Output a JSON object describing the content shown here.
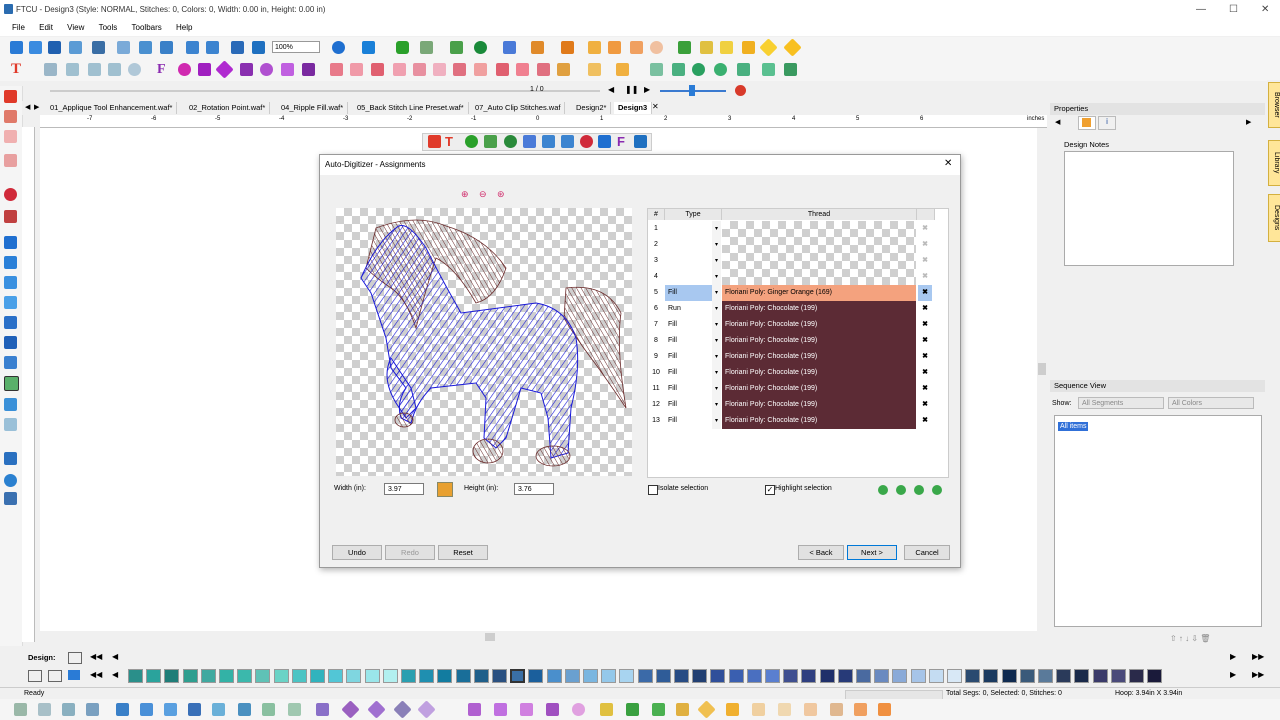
{
  "window": {
    "title": "FTCU - Design3 (Style: NORMAL, Stitches: 0, Colors: 0, Width: 0.00 in, Height: 0.00 in)",
    "minimize": "—",
    "maximize": "☐",
    "close": "✕"
  },
  "menu": [
    "File",
    "Edit",
    "View",
    "Tools",
    "Toolbars",
    "Help"
  ],
  "toolbar": {
    "zoom": "100%",
    "page_counter": "1 / 0"
  },
  "tabs": [
    "01_Applique Tool Enhancement.waf*",
    "02_Rotation Point.waf*",
    "04_Ripple Fill.waf*",
    "05_Back Stitch Line Preset.waf*",
    "07_Auto Clip Stitches.waf",
    "Design2*",
    "Design3"
  ],
  "ruler": {
    "ticks": [
      "-7",
      "-6",
      "-5",
      "-4",
      "-3",
      "-2",
      "-1",
      "0",
      "1",
      "2",
      "3",
      "4",
      "5",
      "6"
    ],
    "unit": "inches"
  },
  "dialog": {
    "title": "Auto-Digitizer - Assignments",
    "width_label": "Width (in):",
    "width_value": "3.97",
    "height_label": "Height (in):",
    "height_value": "3.76",
    "isolate_label": "Isolate selection",
    "isolate_checked": false,
    "highlight_label": "Highlight selection",
    "highlight_checked": true,
    "buttons": {
      "undo": "Undo",
      "redo": "Redo",
      "reset": "Reset",
      "back": "< Back",
      "next": "Next >",
      "cancel": "Cancel"
    },
    "grid": {
      "headers": {
        "num": "#",
        "type": "Type",
        "thread": "Thread"
      },
      "rows": [
        {
          "num": "1",
          "type": "",
          "thread": "",
          "color": ""
        },
        {
          "num": "2",
          "type": "",
          "thread": "",
          "color": ""
        },
        {
          "num": "3",
          "type": "",
          "thread": "",
          "color": ""
        },
        {
          "num": "4",
          "type": "",
          "thread": "",
          "color": ""
        },
        {
          "num": "5",
          "type": "Fill",
          "thread": "Floriani Poly: Ginger Orange (169)",
          "color": "#f4a27e",
          "selected": true
        },
        {
          "num": "6",
          "type": "Run",
          "thread": "Floriani Poly: Chocolate (199)",
          "color": "#5c2b35"
        },
        {
          "num": "7",
          "type": "Fill",
          "thread": "Floriani Poly: Chocolate (199)",
          "color": "#5c2b35"
        },
        {
          "num": "8",
          "type": "Fill",
          "thread": "Floriani Poly: Chocolate (199)",
          "color": "#5c2b35"
        },
        {
          "num": "9",
          "type": "Fill",
          "thread": "Floriani Poly: Chocolate (199)",
          "color": "#5c2b35"
        },
        {
          "num": "10",
          "type": "Fill",
          "thread": "Floriani Poly: Chocolate (199)",
          "color": "#5c2b35"
        },
        {
          "num": "11",
          "type": "Fill",
          "thread": "Floriani Poly: Chocolate (199)",
          "color": "#5c2b35"
        },
        {
          "num": "12",
          "type": "Fill",
          "thread": "Floriani Poly: Chocolate (199)",
          "color": "#5c2b35"
        },
        {
          "num": "13",
          "type": "Fill",
          "thread": "Floriani Poly: Chocolate (199)",
          "color": "#5c2b35"
        }
      ]
    }
  },
  "properties": {
    "title": "Properties",
    "design_notes": "Design Notes"
  },
  "sequence": {
    "title": "Sequence View",
    "show_label": "Show:",
    "segments": "All Segments",
    "colors": "All Colors",
    "item": "All items"
  },
  "side_tabs": [
    "Browser",
    "Library",
    "Designs"
  ],
  "palette": {
    "label": "Design:",
    "swatches": [
      "#2a8f8a",
      "#2aa39c",
      "#1f7d78",
      "#2e9e8f",
      "#40a9a0",
      "#33b2a6",
      "#3bb8ac",
      "#5fc2b6",
      "#6ad3c6",
      "#4bc4c4",
      "#31b3bd",
      "#52c6d6",
      "#7fd6e0",
      "#9ae6ea",
      "#b2f0f0",
      "#2a9fb0",
      "#1f8fb0",
      "#127ca0",
      "#196e99",
      "#1f5f8a",
      "#2a5080",
      "#3a6fa5",
      "#1b5f9c",
      "#4a8fcc",
      "#6aa0d0",
      "#7ab6e0",
      "#94c8ea",
      "#a8d4f0",
      "#3b6aa8",
      "#2f5c98",
      "#284c84",
      "#213f72",
      "#2f4f9a",
      "#3a5fb0",
      "#4a6fc0",
      "#5a7fd0",
      "#3f4f90",
      "#2f3f80",
      "#1f2f6a",
      "#273a78",
      "#4a6aa0",
      "#6a8ac0",
      "#8aaad8",
      "#a6c4e8",
      "#c4dcf2",
      "#d8e8f6",
      "#2a4a70",
      "#1a3a60",
      "#0f2a50",
      "#3a5a7a",
      "#5a7a9a",
      "#2a3a5a",
      "#1a2a4a",
      "#3a3a6a",
      "#4a4a7a",
      "#2a2a4a",
      "#1a1a3a"
    ]
  },
  "status": {
    "left": "Ready",
    "segs": "Total Segs: 0, Selected: 0, Stitches: 0",
    "hoop": "Hoop: 3.94in X 3.94in"
  }
}
